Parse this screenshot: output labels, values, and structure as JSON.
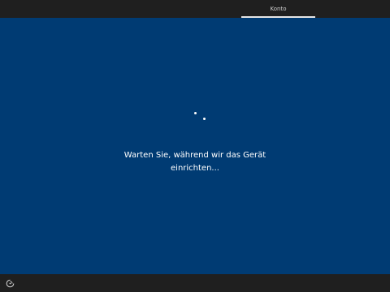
{
  "header": {
    "tabs": [
      {
        "label": "Konto",
        "active": true
      }
    ]
  },
  "main": {
    "message_line1": "Warten Sie, während wir das Gerät",
    "message_line2": "einrichten..."
  },
  "footer": {
    "accessibility_icon": "ease-of-access-icon"
  },
  "colors": {
    "background": "#003b73",
    "bar": "#1f1f1f",
    "text": "#ffffff"
  }
}
